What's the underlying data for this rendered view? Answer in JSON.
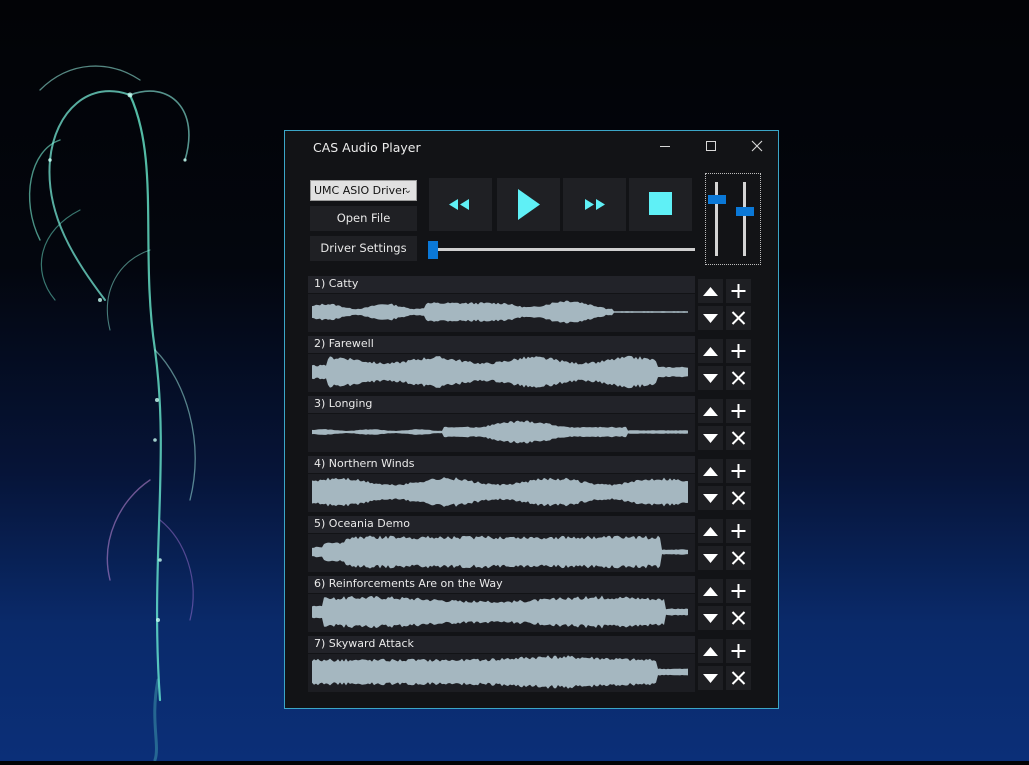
{
  "window": {
    "title": "CAS Audio Player",
    "border_color": "#3ba6c7",
    "controls": {
      "minimize": "minimize-icon",
      "maximize": "maximize-icon",
      "close": "close-icon"
    }
  },
  "driver": {
    "selected": "UMC ASIO Driver"
  },
  "buttons": {
    "open_file": "Open File",
    "driver_settings": "Driver Settings"
  },
  "transport": {
    "accent_color": "#5ff0f6",
    "icons": [
      "rewind-icon",
      "play-icon",
      "fast-forward-icon",
      "stop-icon"
    ]
  },
  "seek": {
    "position": 0.0
  },
  "volume": {
    "left_level": 0.8,
    "right_level": 0.62
  },
  "wave_color": "#a5b7c0",
  "tracks": [
    {
      "label": "1) Catty"
    },
    {
      "label": "2) Farewell"
    },
    {
      "label": "3) Longing"
    },
    {
      "label": "4) Northern Winds"
    },
    {
      "label": "5) Oceania Demo"
    },
    {
      "label": "6) Reinforcements Are on the Way"
    },
    {
      "label": "7) Skyward Attack"
    }
  ],
  "track_controls": [
    "move-up-icon",
    "add-icon",
    "move-down-icon",
    "remove-icon"
  ]
}
